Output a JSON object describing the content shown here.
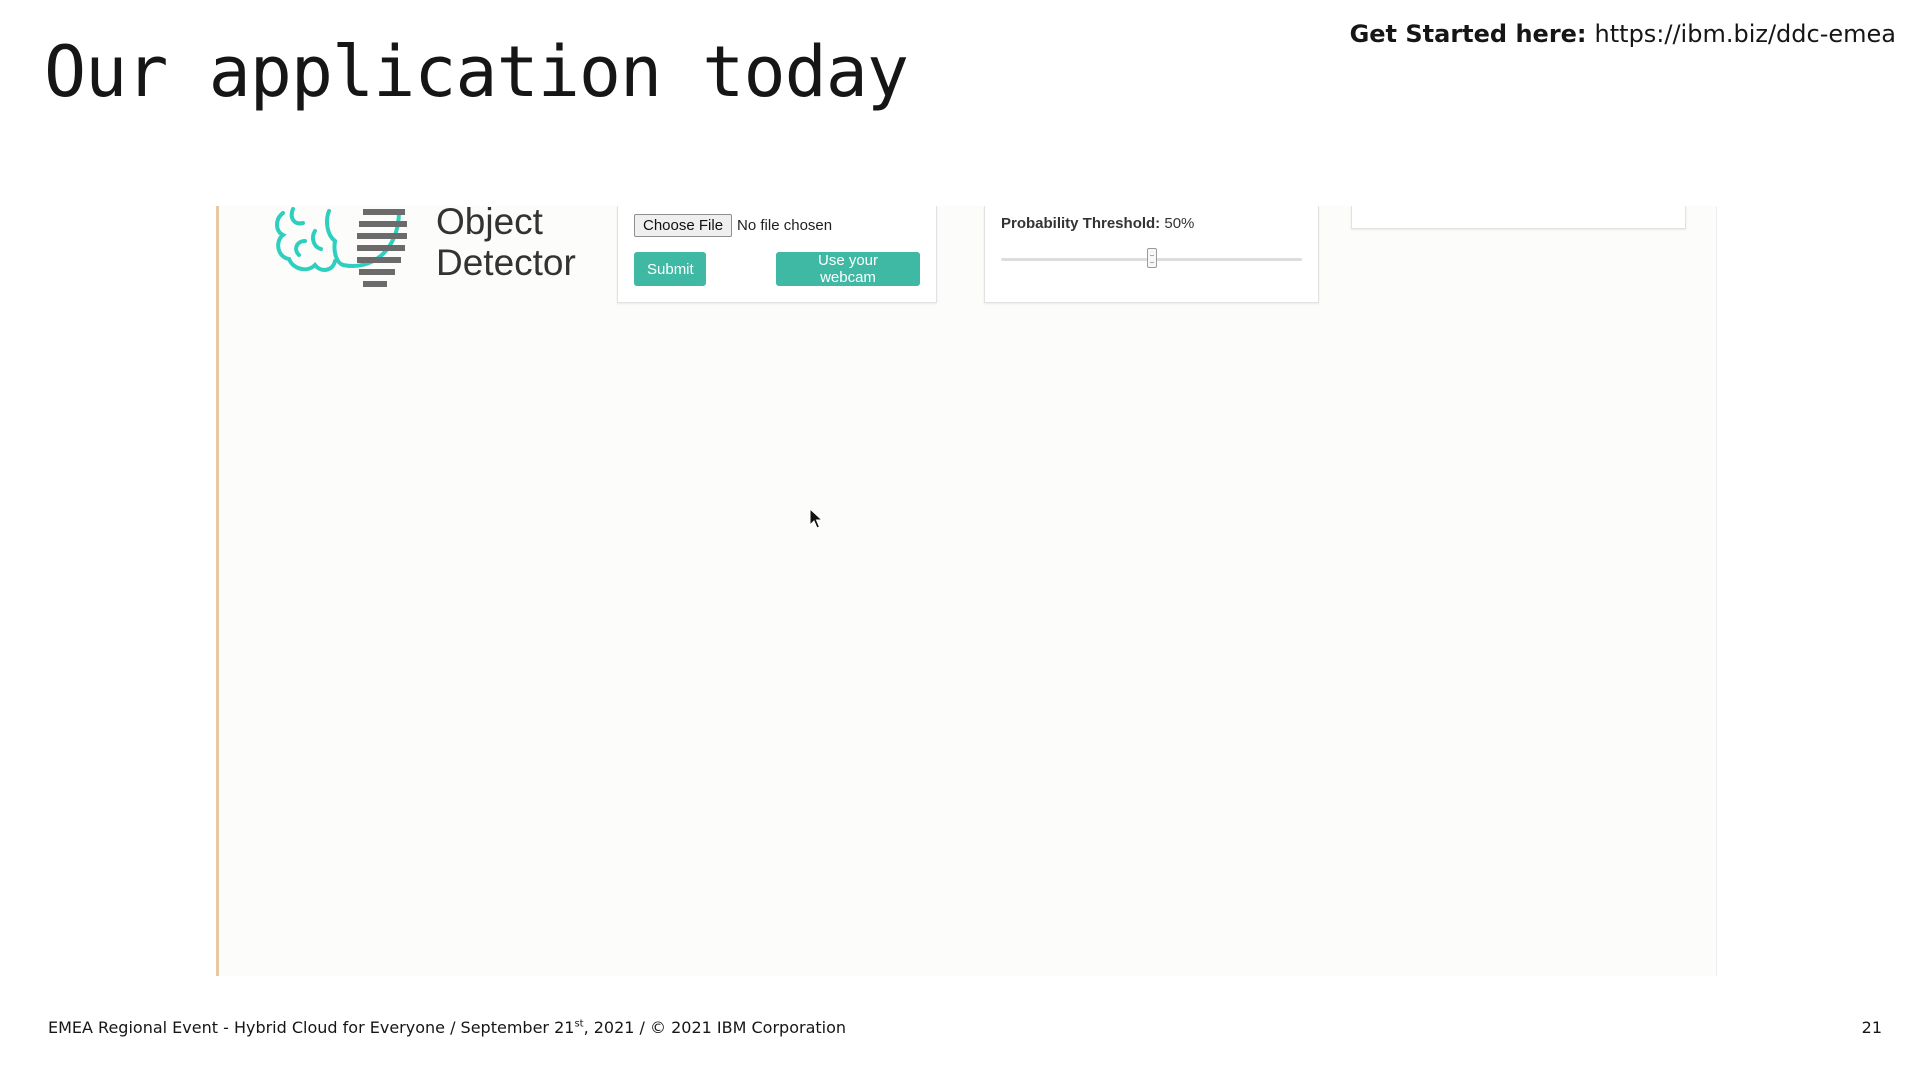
{
  "slide": {
    "title": "Our application today",
    "get_started_label": "Get Started here:",
    "get_started_url": "https://ibm.biz/ddc-emea",
    "footer_prefix": "EMEA Regional Event - Hybrid Cloud for Everyone / September 21",
    "footer_sup": "st",
    "footer_suffix": ", 2021 / © 2021 IBM Corporation",
    "page_number": "21"
  },
  "app": {
    "logo_line1": "Object",
    "logo_line2": "Detector",
    "upload": {
      "choose_file_label": "Choose File",
      "no_file_text": "No file chosen",
      "submit_label": "Submit",
      "webcam_label": "Use your webcam"
    },
    "threshold": {
      "label": "Probability Threshold:",
      "value_text": "50%",
      "value": 0.5
    }
  },
  "colors": {
    "accent": "#3fb8a4",
    "logo_teal": "#2ecfbe",
    "logo_gray": "#6b6b6b"
  },
  "icons": {
    "logo": "brain-stripes-logo-icon",
    "cursor": "mouse-pointer-icon"
  }
}
